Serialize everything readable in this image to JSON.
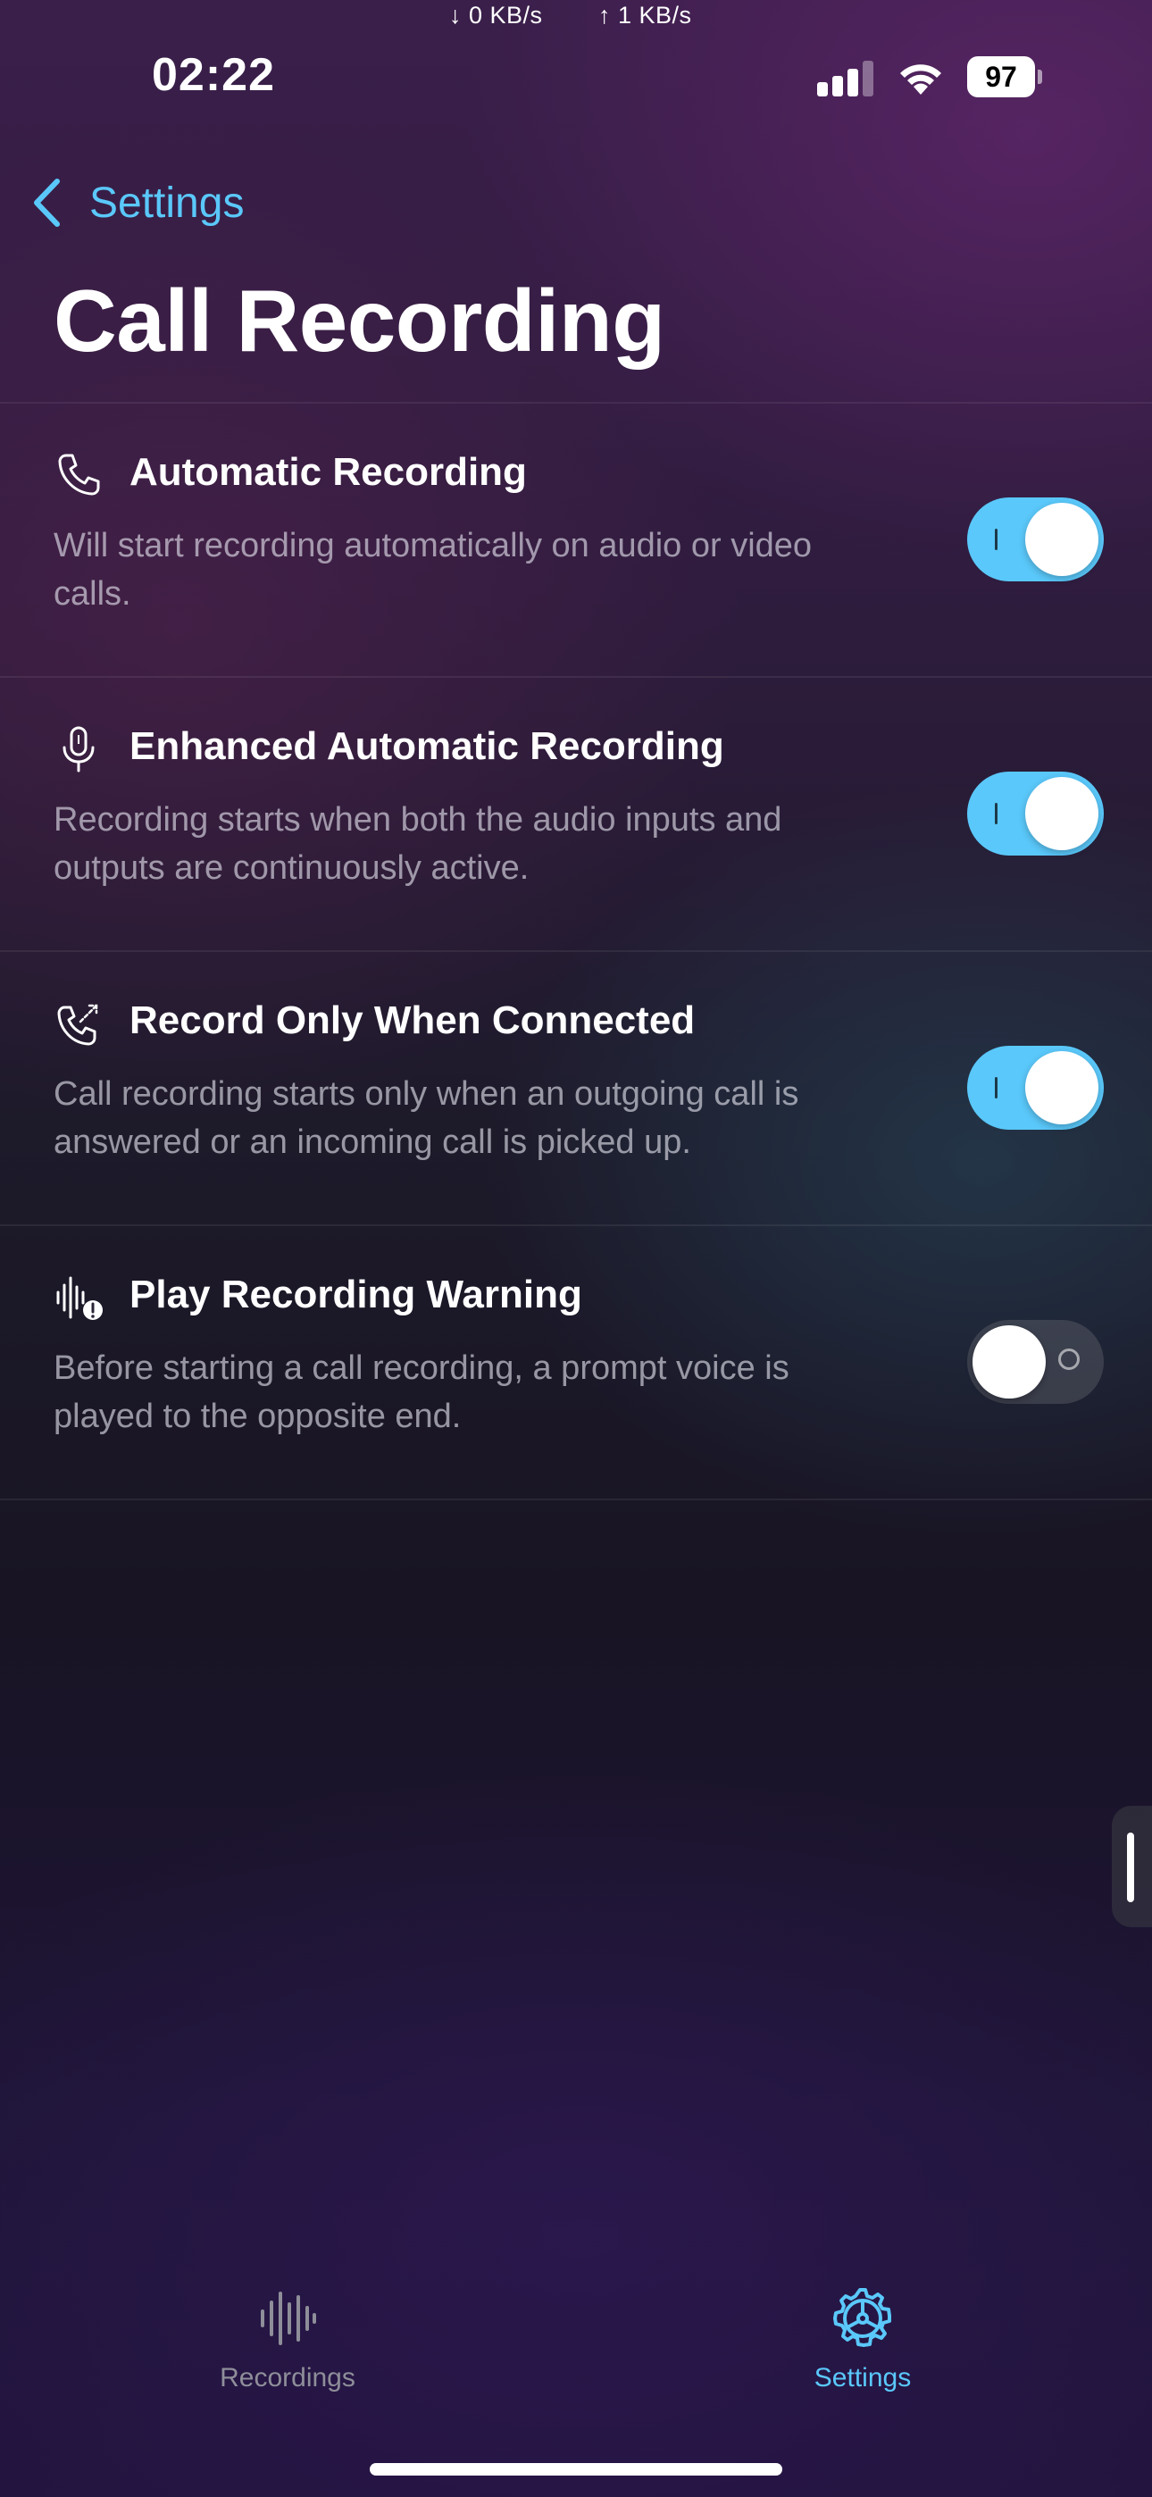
{
  "status_bar": {
    "download_rate": "↓ 0 KB/s",
    "upload_rate": "↑ 1 KB/s",
    "time": "02:22",
    "battery": "97"
  },
  "nav": {
    "back_label": "Settings",
    "title": "Call Recording"
  },
  "settings": [
    {
      "title": "Automatic Recording",
      "description": "Will start recording automatically on audio or video calls.",
      "icon": "phone-icon",
      "enabled": true
    },
    {
      "title": "Enhanced Automatic Recording",
      "description": "Recording starts when both the audio inputs and outputs are continuously active.",
      "icon": "microphone-icon",
      "enabled": true
    },
    {
      "title": "Record Only When Connected",
      "description": "Call recording starts only when an outgoing call is answered or an incoming call is picked up.",
      "icon": "phone-connected-icon",
      "enabled": true
    },
    {
      "title": "Play Recording Warning",
      "description": "Before starting a call recording, a prompt voice is played to the opposite end.",
      "icon": "waveform-warning-icon",
      "enabled": false
    }
  ],
  "tabs": [
    {
      "label": "Recordings",
      "icon": "waveform-icon",
      "active": false
    },
    {
      "label": "Settings",
      "icon": "gear-icon",
      "active": true
    }
  ],
  "colors": {
    "accent": "#5ac8fa",
    "inactive_tab": "#8e8e99"
  }
}
